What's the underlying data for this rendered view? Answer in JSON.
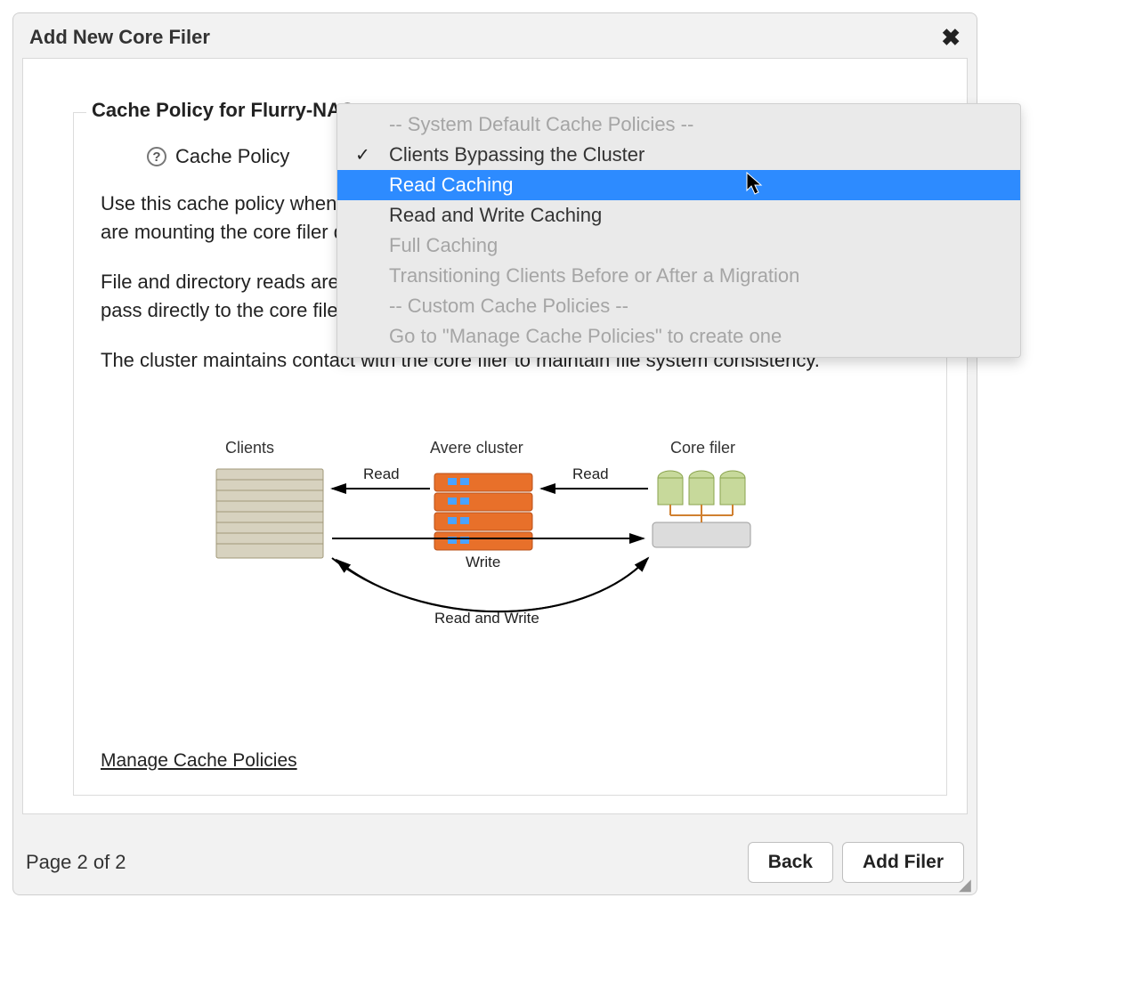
{
  "dialog": {
    "title": "Add New Core Filer",
    "fieldsetLegend": "Cache Policy for Flurry-NAS",
    "policyLabel": "Cache Policy",
    "desc1": "Use this cache policy when some of your clients are mounting the Avere cluster and others are mounting the core filer directly.",
    "desc2": "File and directory reads are cached. Writes from the cluster's clients are not cached; they pass directly to the core filer.",
    "desc3": "The cluster maintains contact with the core filer to maintain file system consistency.",
    "manageLink": "Manage Cache Policies"
  },
  "dropdown": {
    "groupSystem": "-- System Default Cache Policies --",
    "optBypass": "Clients Bypassing the Cluster",
    "optRead": "Read Caching",
    "optRW": "Read and Write Caching",
    "optFull": "Full Caching",
    "optTransition": "Transitioning Clients Before or After a Migration",
    "groupCustom": "-- Custom Cache Policies --",
    "goManage": "Go to \"Manage Cache Policies\" to create one"
  },
  "diagram": {
    "clients": "Clients",
    "avere": "Avere cluster",
    "core": "Core filer",
    "read": "Read",
    "write": "Write",
    "readwrite": "Read and Write"
  },
  "footer": {
    "pager": "Page 2 of 2",
    "back": "Back",
    "add": "Add Filer"
  }
}
